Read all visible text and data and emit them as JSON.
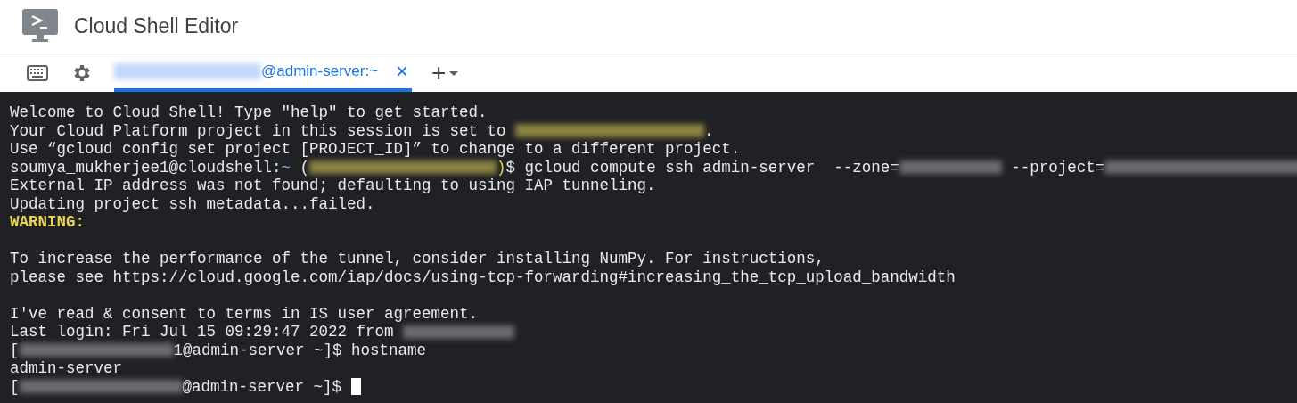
{
  "app": {
    "title": "Cloud Shell Editor"
  },
  "toolbar": {
    "tabs": [
      {
        "selected": true,
        "close": "×",
        "title": [
          {
            "kind": "redacted"
          },
          {
            "kind": "text",
            "text": "@admin-server:~"
          }
        ]
      }
    ],
    "add": "+"
  },
  "terminal": {
    "lines": [
      {
        "kind": "output",
        "segments": [
          {
            "kind": "text",
            "text": "Welcome to Cloud Shell! Type \"help\" to get started."
          }
        ]
      },
      {
        "kind": "output",
        "segments": [
          {
            "kind": "text",
            "text": "Your Cloud Platform project in this session is set to "
          },
          {
            "kind": "redacted",
            "color": "#8c8240"
          },
          {
            "kind": "text",
            "text": "."
          }
        ]
      },
      {
        "kind": "output",
        "segments": [
          {
            "kind": "text",
            "text": "Use “gcloud config set project [PROJECT_ID]” to change to a different project."
          }
        ]
      },
      {
        "kind": "output",
        "segments": [
          {
            "kind": "text",
            "text": "soumya_mukherjee1@cloudshell:"
          },
          {
            "kind": "text",
            "text": "~",
            "color": "#7cacf8"
          },
          {
            "kind": "text",
            "text": " ("
          },
          {
            "kind": "redacted",
            "color": "#8c8240"
          },
          {
            "kind": "text",
            "text": ")",
            "color": "#e8d44d"
          },
          {
            "kind": "text",
            "text": "$ gcloud compute ssh admin-server  --zone="
          },
          {
            "kind": "redacted"
          },
          {
            "kind": "text",
            "text": " --project="
          },
          {
            "kind": "redacted"
          }
        ]
      },
      {
        "kind": "output",
        "segments": [
          {
            "kind": "text",
            "text": "External IP address was not found; defaulting to using IAP tunneling."
          }
        ]
      },
      {
        "kind": "output",
        "segments": [
          {
            "kind": "text",
            "text": "Updating project ssh metadata...failed."
          }
        ]
      },
      {
        "kind": "output",
        "segments": [
          {
            "kind": "text",
            "text": "WARNING:",
            "color": "#e8d44d",
            "bold": true
          }
        ]
      },
      {
        "kind": "blank"
      },
      {
        "kind": "output",
        "segments": [
          {
            "kind": "text",
            "text": "To increase the performance of the tunnel, consider installing NumPy. For instructions,"
          }
        ]
      },
      {
        "kind": "output",
        "segments": [
          {
            "kind": "text",
            "text": "please see https://cloud.google.com/iap/docs/using-tcp-forwarding#increasing_the_tcp_upload_bandwidth"
          }
        ]
      },
      {
        "kind": "blank"
      },
      {
        "kind": "output",
        "segments": [
          {
            "kind": "text",
            "text": "I've read & consent to terms in IS user agreement."
          }
        ]
      },
      {
        "kind": "output",
        "segments": [
          {
            "kind": "text",
            "text": "Last login: Fri Jul 15 09:29:47 2022 from "
          },
          {
            "kind": "redacted"
          }
        ]
      },
      {
        "kind": "output",
        "segments": [
          {
            "kind": "text",
            "text": "["
          },
          {
            "kind": "redacted"
          },
          {
            "kind": "text",
            "text": "1@admin-server ~]$ hostname"
          }
        ]
      },
      {
        "kind": "output",
        "segments": [
          {
            "kind": "text",
            "text": "admin-server"
          }
        ]
      },
      {
        "kind": "output",
        "segments": [
          {
            "kind": "text",
            "text": "["
          },
          {
            "kind": "redacted"
          },
          {
            "kind": "text",
            "text": "@admin-server ~]$ "
          }
        ],
        "cursor": true
      }
    ]
  }
}
